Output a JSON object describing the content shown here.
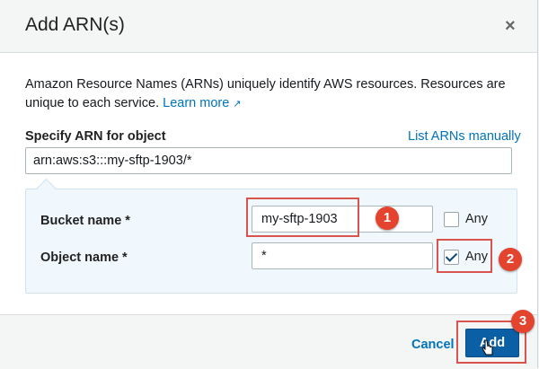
{
  "dialog": {
    "title": "Add ARN(s)",
    "close_label": "×"
  },
  "description": {
    "text": "Amazon Resource Names (ARNs) uniquely identify AWS resources. Resources are unique to each service.",
    "learn_more": "Learn more",
    "external_icon": "external-link-icon"
  },
  "arn": {
    "label": "Specify ARN for object",
    "list_link": "List ARNs manually",
    "value": "arn:aws:s3:::my-sftp-1903/*"
  },
  "bucket": {
    "label": "Bucket name *",
    "value": "my-sftp-1903",
    "any_label": "Any",
    "any_checked": false
  },
  "object": {
    "label": "Object name *",
    "value": "*",
    "any_label": "Any",
    "any_checked": true
  },
  "footer": {
    "cancel_label": "Cancel",
    "add_label": "Add"
  },
  "annotations": [
    "1",
    "2",
    "3"
  ],
  "colors": {
    "link": "#0073bb",
    "primary_button": "#0b5fa5",
    "highlight": "#d9534f",
    "badge": "#e4432e",
    "panel_bg": "#f1f8fd"
  }
}
